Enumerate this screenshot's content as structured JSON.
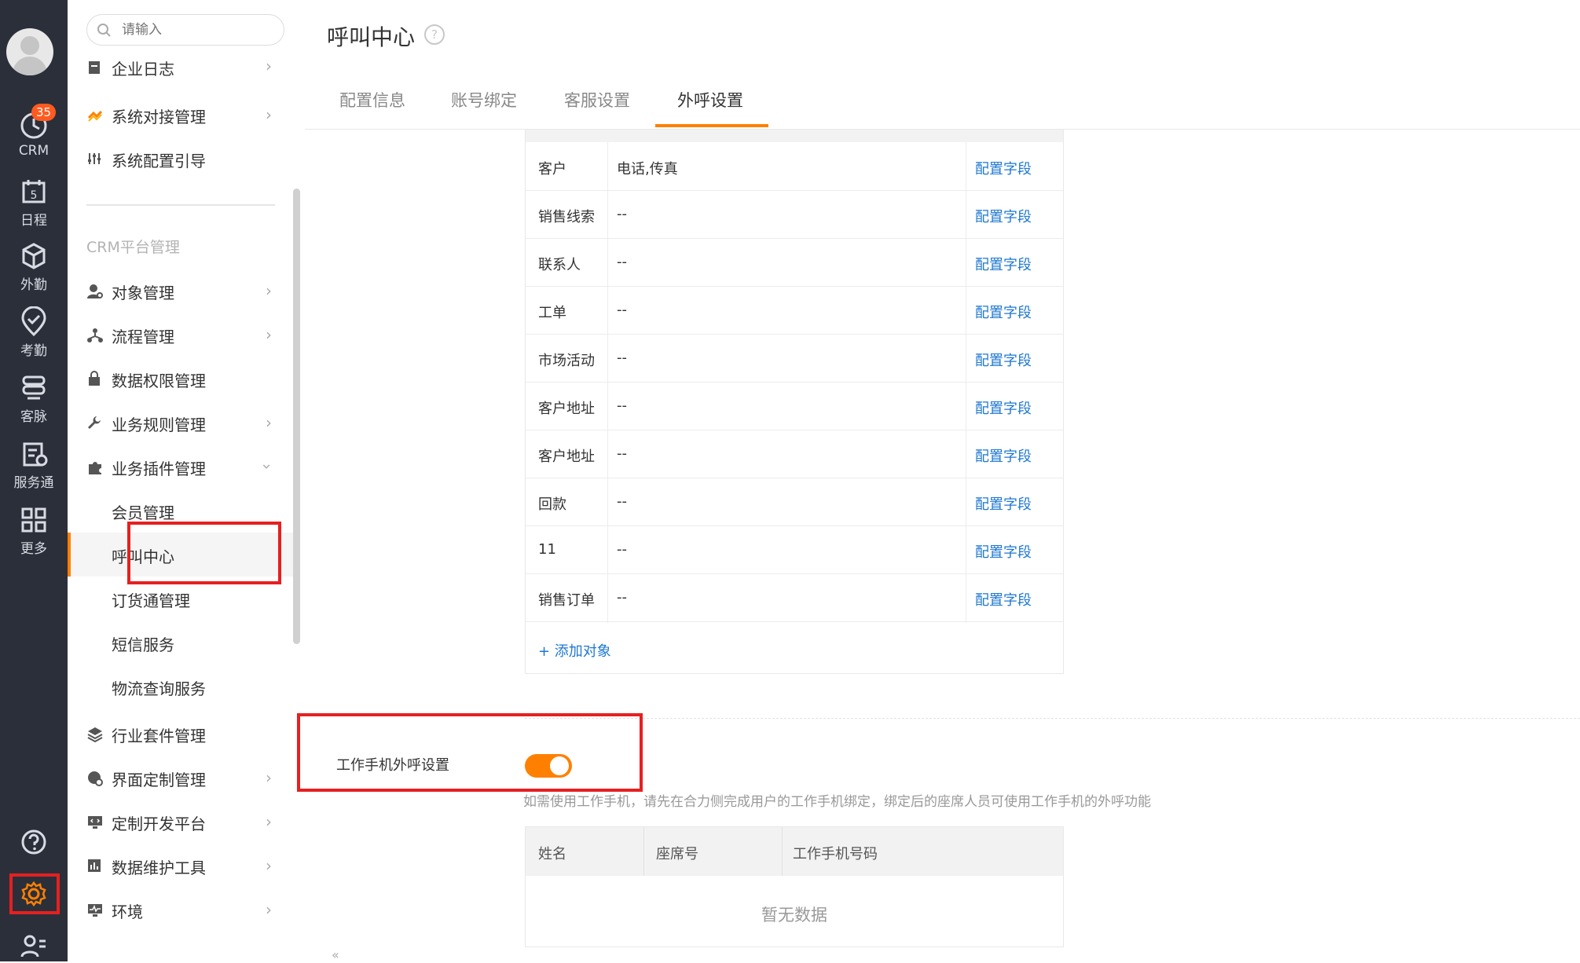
{
  "rail": {
    "crm_badge": "35",
    "items": [
      {
        "label": "CRM"
      },
      {
        "label": "日程",
        "calendar_day": "5"
      },
      {
        "label": "外勤"
      },
      {
        "label": "考勤"
      },
      {
        "label": "客脉"
      },
      {
        "label": "服务通"
      },
      {
        "label": "更多"
      }
    ]
  },
  "menu": {
    "search_placeholder": "请输入",
    "items_top": [
      {
        "label": "企业日志"
      },
      {
        "label": "系统对接管理"
      },
      {
        "label": "系统配置引导"
      }
    ],
    "section_title": "CRM平台管理",
    "items": [
      {
        "label": "对象管理"
      },
      {
        "label": "流程管理"
      },
      {
        "label": "数据权限管理"
      },
      {
        "label": "业务规则管理"
      },
      {
        "label": "业务插件管理"
      }
    ],
    "sub_items": [
      {
        "label": "会员管理"
      },
      {
        "label": "呼叫中心"
      },
      {
        "label": "订货通管理"
      },
      {
        "label": "短信服务"
      },
      {
        "label": "物流查询服务"
      }
    ],
    "items_bottom": [
      {
        "label": "行业套件管理"
      },
      {
        "label": "界面定制管理"
      },
      {
        "label": "定制开发平台"
      },
      {
        "label": "数据维护工具"
      },
      {
        "label": "环境"
      }
    ]
  },
  "main": {
    "title": "呼叫中心",
    "tabs": [
      {
        "label": "配置信息"
      },
      {
        "label": "账号绑定"
      },
      {
        "label": "客服设置"
      },
      {
        "label": "外呼设置"
      }
    ],
    "object_rows": [
      {
        "object": "客户",
        "fields": "电话,传真",
        "action": "配置字段"
      },
      {
        "object": "销售线索",
        "fields": "--",
        "action": "配置字段"
      },
      {
        "object": "联系人",
        "fields": "--",
        "action": "配置字段"
      },
      {
        "object": "工单",
        "fields": "--",
        "action": "配置字段"
      },
      {
        "object": "市场活动",
        "fields": "--",
        "action": "配置字段"
      },
      {
        "object": "客户地址",
        "fields": "--",
        "action": "配置字段"
      },
      {
        "object": "客户地址",
        "fields": "--",
        "action": "配置字段"
      },
      {
        "object": "回款",
        "fields": "--",
        "action": "配置字段"
      },
      {
        "object": "11",
        "fields": "--",
        "action": "配置字段"
      },
      {
        "object": "销售订单",
        "fields": "--",
        "action": "配置字段"
      }
    ],
    "add_object": "+ 添加对象",
    "phone_setting_label": "工作手机外呼设置",
    "phone_setting_enabled": true,
    "phone_desc": "如需使用工作手机，请先在合力侧完成用户的工作手机绑定，绑定后的座席人员可使用工作手机的外呼功能",
    "phone_table": {
      "columns": [
        "姓名",
        "座席号",
        "工作手机号码"
      ],
      "empty_text": "暂无数据"
    }
  },
  "colors": {
    "accent": "#ff8000",
    "link": "#1f78d1",
    "highlight_box": "#e62020",
    "rail_bg": "#2b2f3a"
  }
}
